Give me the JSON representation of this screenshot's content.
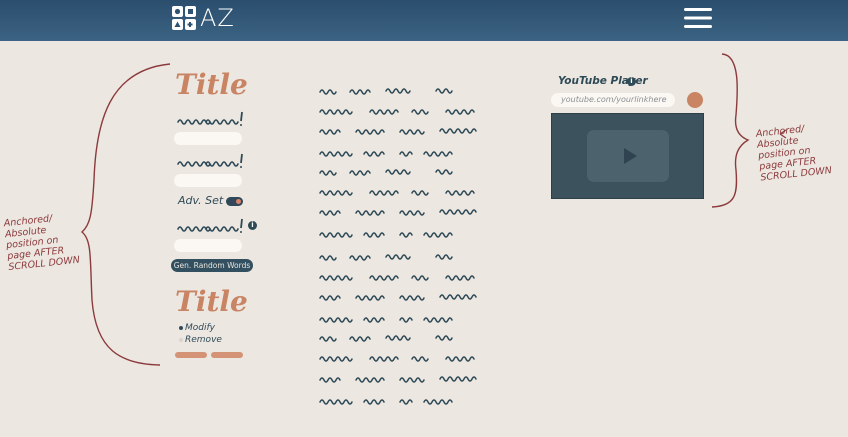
{
  "header": {
    "logo_text": "AZ",
    "logo_icon": "grid-logo-icon",
    "menu_icon": "hamburger-menu-icon"
  },
  "annotations": {
    "left": "Anchored/\nAbsolute\nposition on\npage AFTER\nSCROLL DOWN",
    "right": "Anchored/\nAbsolute\nposition on\npage AFTER\nSCROLL DOWN"
  },
  "sidebar": {
    "title_top": "Title",
    "adv_set_label": "Adv. Set",
    "generate_button": "Gen. Random Words",
    "title_bottom": "Title",
    "radio_options": [
      "Modify",
      "Remove"
    ],
    "info_icon": "i"
  },
  "youtube": {
    "label": "YouTube Player",
    "input_placeholder": "youtube.com/yourlinkhere",
    "info_icon": "i",
    "play_icon": "play-icon"
  },
  "colors": {
    "background": "#ece7e1",
    "header": "#2f5270",
    "accent": "#c88463",
    "ink": "#2f4a57",
    "annotation": "#8c3a3c",
    "player": "#3c525c"
  }
}
